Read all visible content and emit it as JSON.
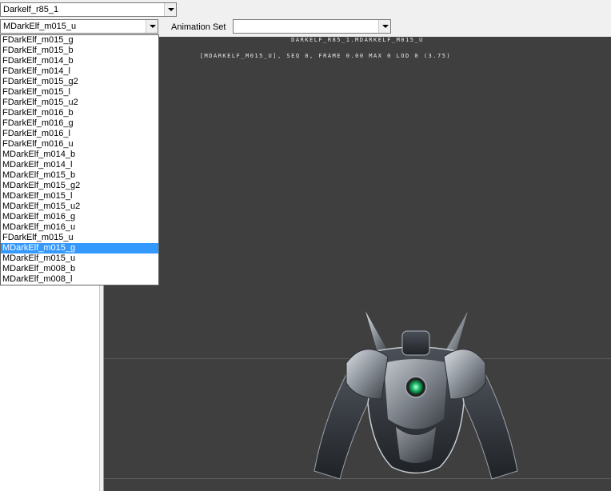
{
  "model_select": {
    "value": "Darkelf_r85_1"
  },
  "part_select": {
    "value": "MDarkElf_m015_u"
  },
  "animation": {
    "label": "Animation Set",
    "value": ""
  },
  "viewport": {
    "title": "DARKELF_R85_1.MDARKELF_M015_U",
    "info": "[MDARKELF_M015_U], SEQ 0,  FRAME  0.00 MAX 0  LOD 0 (3.75)"
  },
  "dropdown": {
    "selected_index": 20,
    "items": [
      "FDarkElf_m015_g",
      "FDarkElf_m015_b",
      "FDarkElf_m014_b",
      "FDarkElf_m014_l",
      "FDarkElf_m015_g2",
      "FDarkElf_m015_l",
      "FDarkElf_m015_u2",
      "FDarkElf_m016_b",
      "FDarkElf_m016_g",
      "FDarkElf_m016_l",
      "FDarkElf_m016_u",
      "MDarkElf_m014_b",
      "MDarkElf_m014_l",
      "MDarkElf_m015_b",
      "MDarkElf_m015_g2",
      "MDarkElf_m015_l",
      "MDarkElf_m015_u2",
      "MDarkElf_m016_g",
      "MDarkElf_m016_u",
      "FDarkElf_m015_u",
      "MDarkElf_m015_g",
      "MDarkElf_m015_u",
      "MDarkElf_m008_b",
      "MDarkElf_m008_l"
    ]
  }
}
